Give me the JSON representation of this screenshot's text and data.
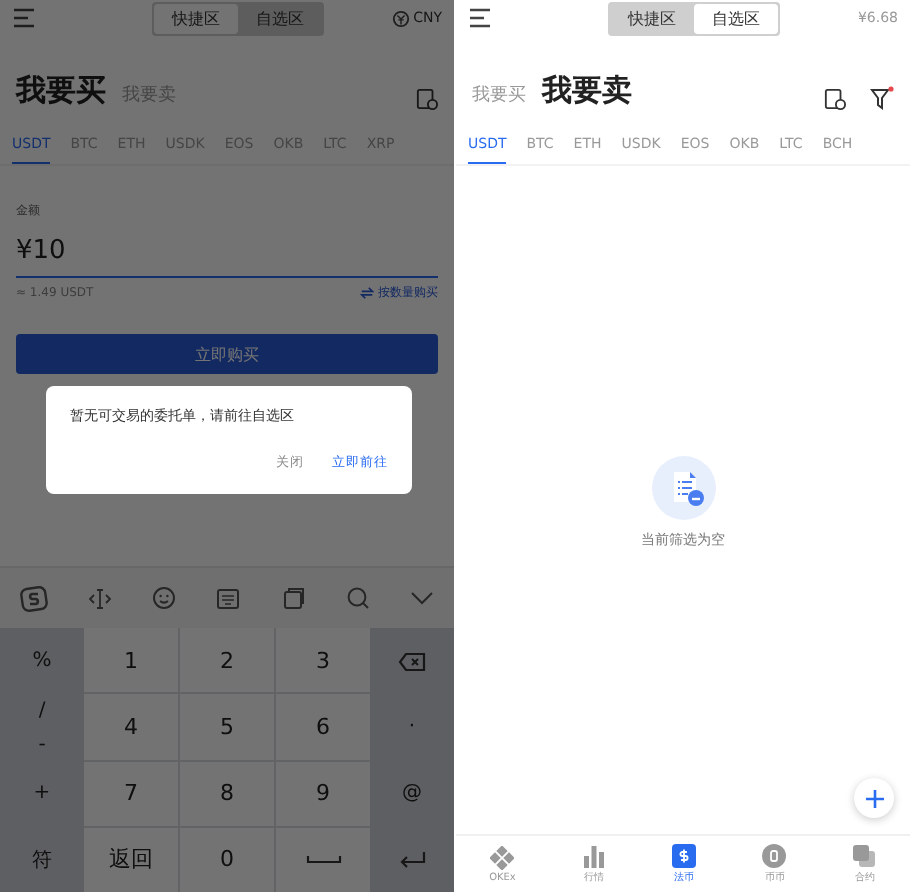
{
  "left": {
    "segments": [
      {
        "label": "快捷区",
        "selected": true
      },
      {
        "label": "自选区",
        "selected": false
      }
    ],
    "currency": "CNY",
    "title": {
      "main": "我要买",
      "alt": "我要卖"
    },
    "tabs": [
      {
        "label": "USDT",
        "selected": true
      },
      {
        "label": "BTC",
        "selected": false
      },
      {
        "label": "ETH",
        "selected": false
      },
      {
        "label": "USDK",
        "selected": false
      },
      {
        "label": "EOS",
        "selected": false
      },
      {
        "label": "OKB",
        "selected": false
      },
      {
        "label": "LTC",
        "selected": false
      },
      {
        "label": "XRP",
        "selected": false
      }
    ],
    "amount": {
      "label": "金额",
      "value": "¥10",
      "estimate": "≈ 1.49 USDT",
      "switch_link": "按数量购买"
    },
    "buy_button": "立即购买",
    "dialog": {
      "message": "暂无可交易的委托单，请前往自选区",
      "cancel": "关闭",
      "confirm": "立即前往"
    },
    "keyboard": {
      "side_keys": [
        [
          "%"
        ],
        [
          "/",
          "-"
        ],
        [
          "+"
        ],
        [
          "符"
        ]
      ],
      "keys": [
        {
          "kind": "text",
          "label": "1"
        },
        {
          "kind": "text",
          "label": "2"
        },
        {
          "kind": "text",
          "label": "3"
        },
        {
          "kind": "text",
          "label": "4"
        },
        {
          "kind": "text",
          "label": "5"
        },
        {
          "kind": "text",
          "label": "6"
        },
        {
          "kind": "text",
          "label": "7"
        },
        {
          "kind": "text",
          "label": "8"
        },
        {
          "kind": "text",
          "label": "9"
        },
        {
          "kind": "text",
          "label": "返回"
        },
        {
          "kind": "text",
          "label": "0"
        },
        {
          "kind": "space"
        }
      ],
      "right_keys": [
        {
          "kind": "backspace"
        },
        {
          "kind": "text",
          "label": "·"
        },
        {
          "kind": "text",
          "label": "@"
        },
        {
          "kind": "enter"
        }
      ]
    }
  },
  "right": {
    "segments": [
      {
        "label": "快捷区",
        "selected": false
      },
      {
        "label": "自选区",
        "selected": true
      }
    ],
    "price": "¥6.68",
    "title": {
      "alt": "我要买",
      "main": "我要卖"
    },
    "tabs": [
      {
        "label": "USDT",
        "selected": true
      },
      {
        "label": "BTC",
        "selected": false
      },
      {
        "label": "ETH",
        "selected": false
      },
      {
        "label": "USDK",
        "selected": false
      },
      {
        "label": "EOS",
        "selected": false
      },
      {
        "label": "OKB",
        "selected": false
      },
      {
        "label": "LTC",
        "selected": false
      },
      {
        "label": "BCH",
        "selected": false
      }
    ],
    "empty_text": "当前筛选为空",
    "nav": [
      {
        "label": "OKEx",
        "selected": false
      },
      {
        "label": "行情",
        "selected": false
      },
      {
        "label": "法币",
        "selected": true
      },
      {
        "label": "币币",
        "selected": false
      },
      {
        "label": "合约",
        "selected": false
      }
    ]
  }
}
